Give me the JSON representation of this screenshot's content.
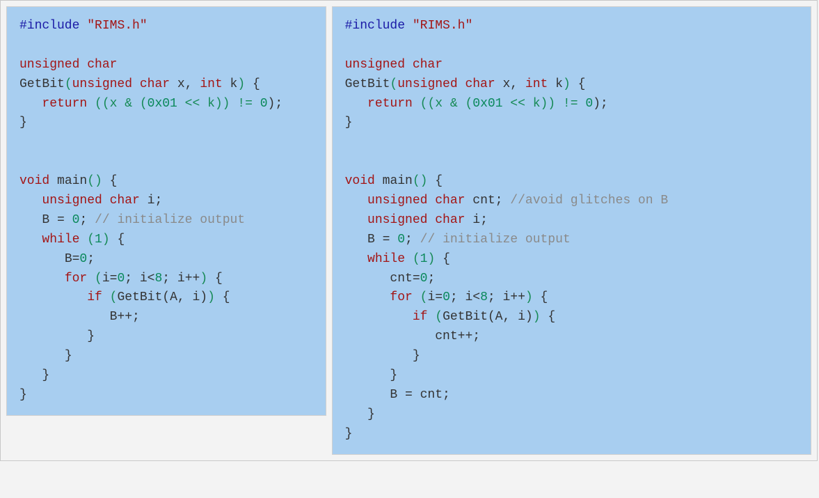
{
  "left": {
    "include_kw": "#include",
    "include_hdr": "\"RIMS.h\"",
    "fn_ret": "unsigned char",
    "fn_name": "GetBit",
    "fn_params_1": "unsigned char",
    "fn_param1": "x",
    "fn_params_2": "int",
    "fn_param2": "k",
    "fn_body_return": "return",
    "fn_body_expr_pre": "((x & (",
    "fn_body_hex": "0x01",
    "fn_body_expr_post": " << k)) != ",
    "fn_body_zero": "0",
    "fn_body_tail": ");",
    "void": "void",
    "main": "main",
    "decl1": "unsigned char",
    "decl1_var": "i",
    "binit_lhs": "B = ",
    "binit_zero": "0",
    "binit_semi": ";",
    "binit_cmt": "// initialize output",
    "while": "while",
    "while_expr": "1",
    "l_bzero": "B=",
    "l_bzero_0": "0",
    "for": "for",
    "for_i": "i=",
    "for_i0": "0",
    "for_sep1": "; i<",
    "for_lim": "8",
    "for_sep2": "; i++",
    "if": "if",
    "if_call": "GetBit(A, i)",
    "binc": "B++;"
  },
  "right": {
    "include_kw": "#include",
    "include_hdr": "\"RIMS.h\"",
    "fn_ret": "unsigned char",
    "fn_name": "GetBit",
    "fn_params_1": "unsigned char",
    "fn_param1": "x",
    "fn_params_2": "int",
    "fn_param2": "k",
    "fn_body_return": "return",
    "fn_body_expr_pre": "((x & (",
    "fn_body_hex": "0x01",
    "fn_body_expr_post": " << k)) != ",
    "fn_body_zero": "0",
    "fn_body_tail": ");",
    "void": "void",
    "main": "main",
    "decl_cnt": "unsigned char",
    "decl_cnt_var": "cnt",
    "decl_cnt_cmt": "//avoid glitches on B",
    "decl_i": "unsigned char",
    "decl_i_var": "i",
    "binit_lhs": "B = ",
    "binit_zero": "0",
    "binit_semi": ";",
    "binit_cmt": "// initialize output",
    "while": "while",
    "while_expr": "1",
    "cnt0": "cnt=",
    "cnt0_0": "0",
    "for": "for",
    "for_i": "i=",
    "for_i0": "0",
    "for_sep1": "; i<",
    "for_lim": "8",
    "for_sep2": "; i++",
    "if": "if",
    "if_call": "GetBit(A, i)",
    "cntinc": "cnt++;",
    "assignB": "B = cnt;"
  }
}
